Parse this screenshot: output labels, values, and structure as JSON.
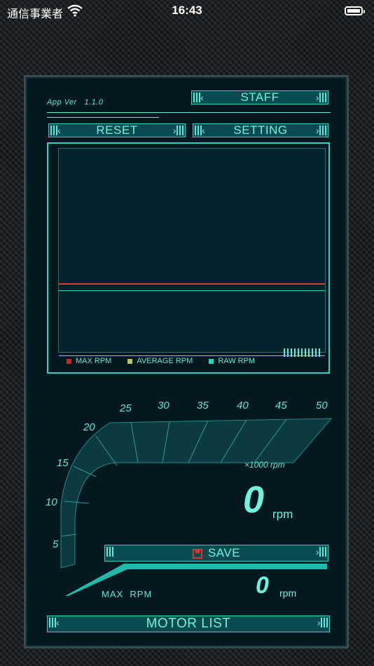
{
  "status_bar": {
    "carrier": "通信事業者",
    "time": "16:43"
  },
  "app": {
    "version_label": "App Ver",
    "version": "1.1.0"
  },
  "buttons": {
    "staff": "STAFF",
    "reset": "RESET",
    "setting": "SETTING",
    "save": "SAVE",
    "motor_list": "MOTOR LIST"
  },
  "legend": [
    {
      "label": "MAX RPM",
      "color": "#c62828"
    },
    {
      "label": "AVERAGE RPM",
      "color": "#b7c36a"
    },
    {
      "label": "RAW RPM",
      "color": "#2bd3c2"
    }
  ],
  "gauge": {
    "ticks": [
      "5",
      "10",
      "15",
      "20",
      "25",
      "30",
      "35",
      "40",
      "45",
      "50"
    ],
    "scale_unit": "×1000 rpm",
    "current_rpm": "0",
    "rpm_unit": "rpm",
    "max_label": "MAX  RPM",
    "max_rpm": "0"
  },
  "colors": {
    "accent": "#5fe9d6",
    "panel": "#041820",
    "max_line": "#e53935"
  }
}
